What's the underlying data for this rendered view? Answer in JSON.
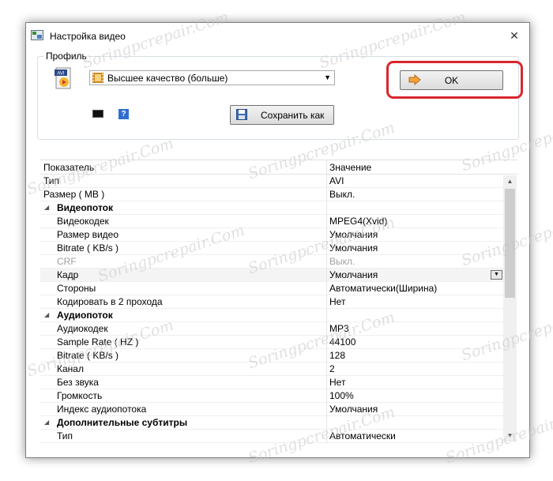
{
  "window": {
    "title": "Настройка видео",
    "close_glyph": "✕"
  },
  "profile": {
    "legend": "Профиль",
    "selected": "Высшее качество (больше)",
    "format_icon_label": "AVI",
    "ok_label": "OK",
    "save_as_label": "Сохранить как",
    "help_glyph": "?"
  },
  "grid": {
    "headers": {
      "name": "Показатель",
      "value": "Значение"
    },
    "rows": [
      {
        "name": "Тип",
        "value": "AVI"
      },
      {
        "name": "Размер ( MB )",
        "value": "Выкл."
      },
      {
        "name": "Видеопоток",
        "value": ""
      },
      {
        "name": "Видеокодек",
        "value": "MPEG4(Xvid)"
      },
      {
        "name": "Размер видео",
        "value": "Умолчания"
      },
      {
        "name": "Bitrate ( KB/s )",
        "value": "Умолчания"
      },
      {
        "name": "CRF",
        "value": "Выкл."
      },
      {
        "name": "Кадр",
        "value": "Умолчания"
      },
      {
        "name": "Стороны",
        "value": "Автоматически(Ширина)"
      },
      {
        "name": "Кодировать в 2 прохода",
        "value": "Нет"
      },
      {
        "name": "Аудиопоток",
        "value": ""
      },
      {
        "name": "Аудиокодек",
        "value": "MP3"
      },
      {
        "name": "Sample Rate ( HZ )",
        "value": "44100"
      },
      {
        "name": "Bitrate ( KB/s )",
        "value": "128"
      },
      {
        "name": "Канал",
        "value": "2"
      },
      {
        "name": "Без звука",
        "value": "Нет"
      },
      {
        "name": "Громкость",
        "value": "100%"
      },
      {
        "name": "Индекс аудиопотока",
        "value": "Умолчания"
      },
      {
        "name": "Дополнительные субтитры",
        "value": ""
      },
      {
        "name": "Тип",
        "value": "Автоматически"
      }
    ]
  },
  "watermark": "Soringpcrepair.Com",
  "colors": {
    "highlight": "#d9262d",
    "help_icon": "#2f6fd2"
  }
}
